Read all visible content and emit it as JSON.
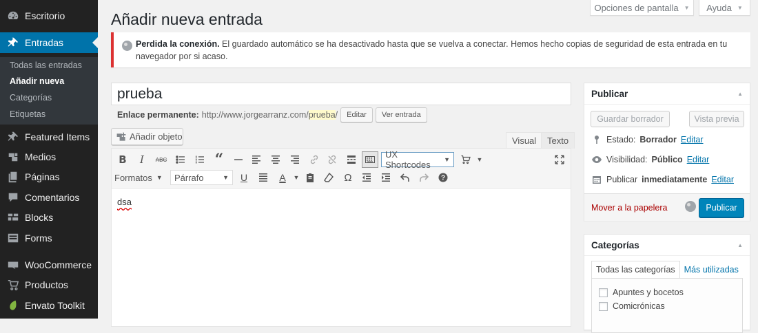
{
  "sidebar": {
    "items": [
      {
        "label": "Escritorio",
        "icon": "dashboard-icon"
      },
      {
        "label": "Entradas",
        "icon": "pushpin-icon"
      },
      {
        "label": "Featured Items",
        "icon": "pushpin-icon"
      },
      {
        "label": "Medios",
        "icon": "media-icon"
      },
      {
        "label": "Páginas",
        "icon": "pages-icon"
      },
      {
        "label": "Comentarios",
        "icon": "comment-icon"
      },
      {
        "label": "Blocks",
        "icon": "blocks-icon"
      },
      {
        "label": "Forms",
        "icon": "forms-icon"
      },
      {
        "label": "WooCommerce",
        "icon": "woocommerce-icon"
      },
      {
        "label": "Productos",
        "icon": "cart-icon"
      },
      {
        "label": "Envato Toolkit",
        "icon": "leaf-icon"
      }
    ],
    "submenu": [
      "Todas las entradas",
      "Añadir nueva",
      "Categorías",
      "Etiquetas"
    ],
    "accent": "#0073aa"
  },
  "screen_meta": {
    "options_label": "Opciones de pantalla",
    "help_label": "Ayuda"
  },
  "page_title": "Añadir nueva entrada",
  "notice": {
    "bold": "Perdida la conexión.",
    "text": " El guardado automático se ha desactivado hasta que se vuelva a conectar. Hemos hecho copias de seguridad de esta entrada en tu navegador por si acaso.",
    "color": "#dc3232"
  },
  "post": {
    "title": "prueba",
    "permalink_label": "Enlace permanente:",
    "permalink_base": "http://www.jorgearranz.com/",
    "permalink_slug": "prueba",
    "permalink_end": "/",
    "edit_label": "Editar",
    "view_label": "Ver entrada"
  },
  "editor": {
    "add_media_label": "Añadir objeto",
    "tab_visual": "Visual",
    "tab_text": "Texto",
    "ux_shortcodes": "UX Shortcodes",
    "formats": "Formatos",
    "paragraph": "Párrafo",
    "content": "dsa"
  },
  "publish": {
    "heading": "Publicar",
    "save_draft": "Guardar borrador",
    "preview": "Vista previa",
    "status_label": "Estado:",
    "status_value": "Borrador",
    "visibility_label": "Visibilidad:",
    "visibility_value": "Público",
    "schedule_label": "Publicar",
    "schedule_value": "inmediatamente",
    "edit_link": "Editar",
    "trash": "Mover a la papelera",
    "publish_button": "Publicar",
    "button_color": "#0085ba"
  },
  "categories": {
    "heading": "Categorías",
    "tab_all": "Todas las categorías",
    "tab_popular": "Más utilizadas",
    "items": [
      "Apuntes y bocetos",
      "Comicrónicas"
    ]
  }
}
